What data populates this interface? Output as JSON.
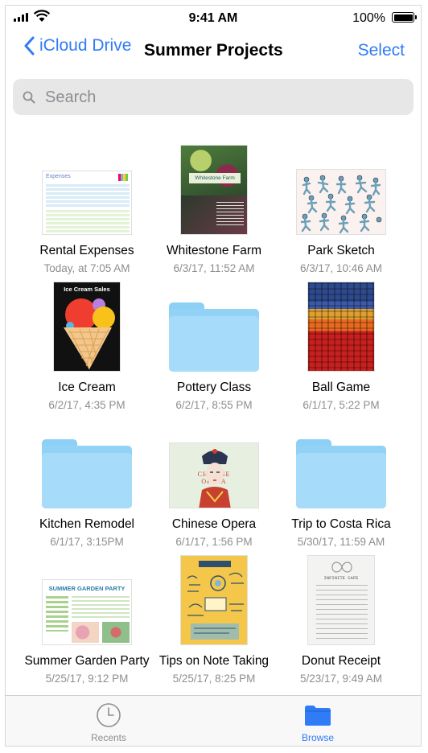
{
  "status": {
    "time": "9:41 AM",
    "battery": "100%"
  },
  "nav": {
    "back_label": "iCloud Drive",
    "title": "Summer Projects",
    "select_label": "Select"
  },
  "search": {
    "placeholder": "Search"
  },
  "items": [
    {
      "name": "Rental Expenses",
      "date": "Today, at 7:05 AM",
      "kind": "spreadsheet",
      "thumb_title": "Expenses"
    },
    {
      "name": "Whitestone Farm",
      "date": "6/3/17, 11:52 AM",
      "kind": "document",
      "thumb_title": "Whitestone Farm"
    },
    {
      "name": "Park Sketch",
      "date": "6/3/17, 10:46 AM",
      "kind": "sketch"
    },
    {
      "name": "Ice Cream",
      "date": "6/2/17, 4:35 PM",
      "kind": "poster",
      "thumb_title": "Ice Cream Sales"
    },
    {
      "name": "Pottery Class",
      "date": "6/2/17, 8:55 PM",
      "kind": "folder"
    },
    {
      "name": "Ball Game",
      "date": "6/1/17, 5:22 PM",
      "kind": "photo"
    },
    {
      "name": "Kitchen Remodel",
      "date": "6/1/17, 3:15PM",
      "kind": "folder"
    },
    {
      "name": "Chinese Opera",
      "date": "6/1/17, 1:56 PM",
      "kind": "presentation",
      "thumb_title": "CHINESE OPERA"
    },
    {
      "name": "Trip to Costa Rica",
      "date": "5/30/17, 11:59 AM",
      "kind": "folder"
    },
    {
      "name": "Summer Garden Party",
      "date": "5/25/17, 9:12 PM",
      "kind": "spreadsheet",
      "thumb_title": "SUMMER GARDEN PARTY"
    },
    {
      "name": "Tips on Note Taking",
      "date": "5/25/17, 8:25 PM",
      "kind": "notes"
    },
    {
      "name": "Donut Receipt",
      "date": "5/23/17, 9:49 AM",
      "kind": "receipt",
      "thumb_title": "INFINITE CAFE"
    }
  ],
  "tabs": [
    {
      "label": "Recents",
      "icon": "clock-icon",
      "active": false
    },
    {
      "label": "Browse",
      "icon": "folder-icon",
      "active": true
    }
  ],
  "colors": {
    "accent": "#2f7cf6",
    "inactive": "#8e8e93",
    "folder": "#a6dbfa"
  }
}
